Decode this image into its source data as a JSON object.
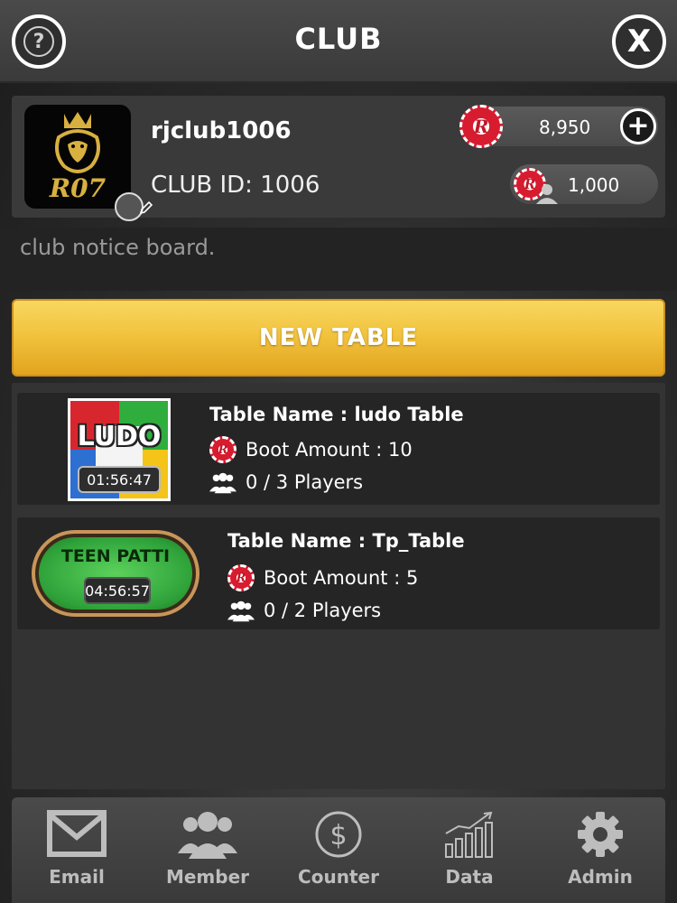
{
  "header": {
    "title": "CLUB",
    "help_symbol": "?",
    "close_symbol": "X"
  },
  "club": {
    "name": "rjclub1006",
    "club_id_text": "CLUB ID: 1006",
    "logo_text": "R07",
    "balance": "8,950",
    "secondary_balance": "1,000",
    "chip_letter": "R",
    "add_symbol": "+"
  },
  "notice": {
    "text": "club notice board."
  },
  "new_table": {
    "label": "NEW TABLE"
  },
  "tables": [
    {
      "game": "LUDO",
      "timer": "01:56:47",
      "name_text": "Table Name : ludo Table",
      "boot_text": "Boot Amount : 10",
      "players_text": "0 / 3 Players"
    },
    {
      "game": "TEEN PATTI",
      "timer": "04:56:57",
      "name_text": "Table Name : Tp_Table",
      "boot_text": "Boot Amount : 5",
      "players_text": "0 / 2 Players"
    }
  ],
  "nav": [
    {
      "label": "Email",
      "icon": "envelope-icon"
    },
    {
      "label": "Member",
      "icon": "group-icon"
    },
    {
      "label": "Counter",
      "icon": "dollar-icon"
    },
    {
      "label": "Data",
      "icon": "chart-icon"
    },
    {
      "label": "Admin",
      "icon": "gear-icon"
    }
  ],
  "colors": {
    "accent_gold": "#f2c33e",
    "chip_red": "#d81c30",
    "panel": "#3a3a3a"
  }
}
